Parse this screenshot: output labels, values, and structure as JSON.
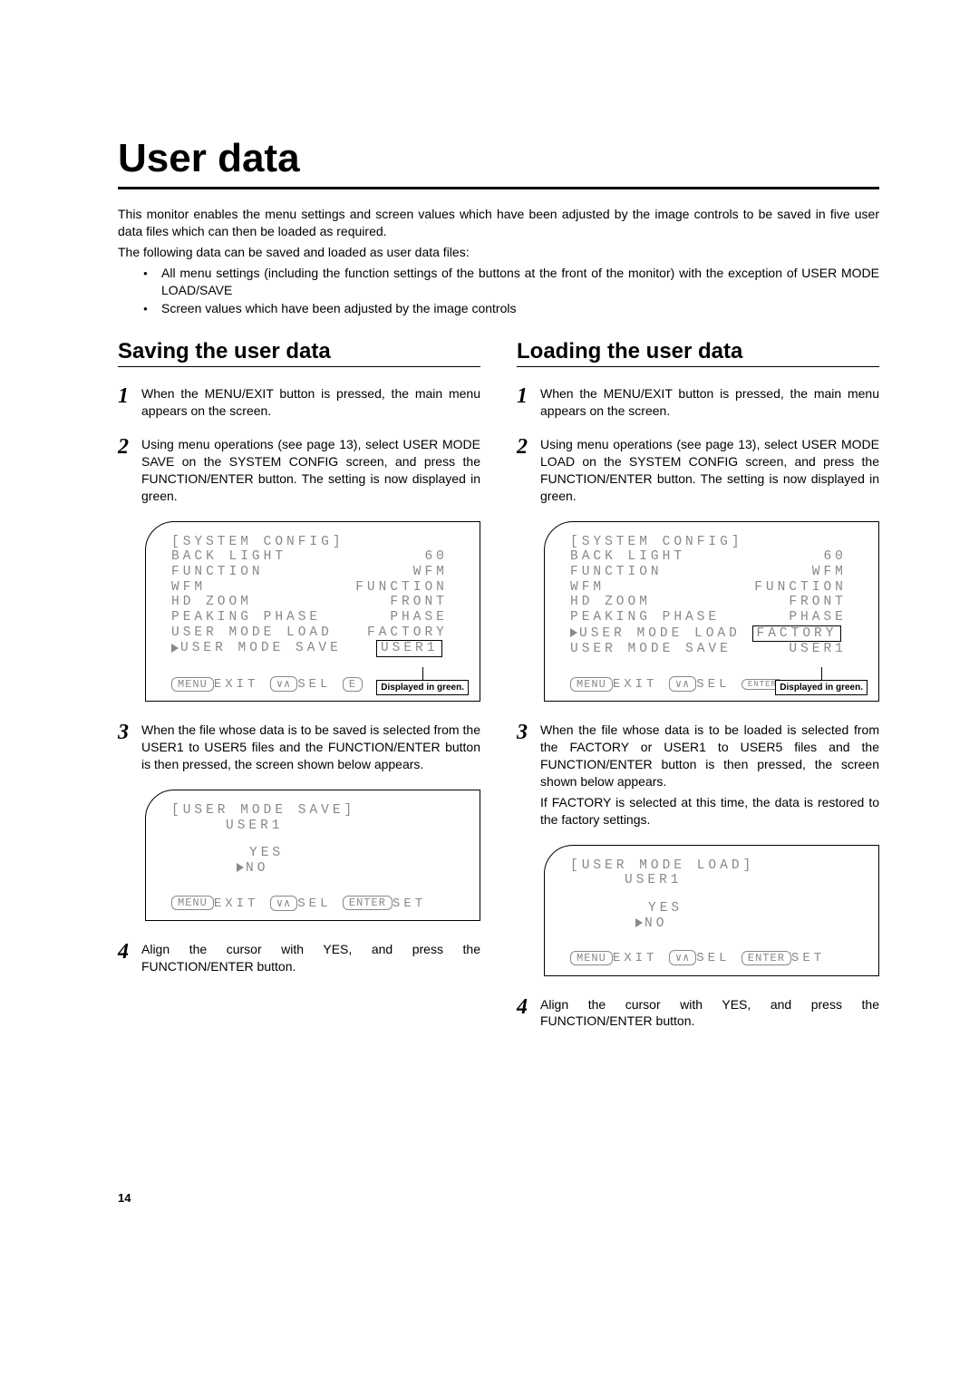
{
  "title": "User data",
  "intro_p1": "This monitor enables the menu settings and screen values which have been adjusted by the image controls to be saved in five user data files which can then be loaded as required.",
  "intro_p2": "The following data can be saved and loaded as user data files:",
  "bullets": [
    "All menu settings (including the function settings of the buttons at the front of the monitor) with the exception of USER MODE LOAD/SAVE",
    "Screen values which have been adjusted by the image controls"
  ],
  "saving": {
    "heading": "Saving the user data",
    "steps": [
      "When the MENU/EXIT button is pressed, the main menu appears on the screen.",
      "Using menu operations (see page 13), select USER MODE SAVE on the SYSTEM CONFIG screen, and press the FUNCTION/ENTER button.  The setting is now displayed in green.",
      "When the file whose data is to be saved is selected from the USER1 to USER5 files and the FUNCTION/ENTER button is then pressed, the screen shown below appears.",
      "Align the cursor with YES, and press the FUNCTION/ENTER button."
    ]
  },
  "loading": {
    "heading": "Loading the user data",
    "steps": [
      "When the MENU/EXIT button is pressed, the main menu appears on the screen.",
      "Using menu operations (see page 13), select USER MODE LOAD on the SYSTEM CONFIG screen, and press the FUNCTION/ENTER button.  The setting is now displayed in green.",
      "When the file whose data is to be loaded is selected from the FACTORY or USER1 to USER5 files and the FUNCTION/ENTER button is then pressed, the screen shown below appears.",
      "Align the cursor with YES, and press the FUNCTION/ENTER button."
    ],
    "step3_extra": "If FACTORY is selected at this time, the data is restored to the factory settings."
  },
  "screen_syscfg": {
    "title": "[SYSTEM CONFIG]",
    "rows": {
      "back_light": {
        "label": "BACK LIGHT",
        "value": "60"
      },
      "function": {
        "label": "FUNCTION",
        "value": "WFM"
      },
      "wfm": {
        "label": "WFM",
        "value": "FUNCTION"
      },
      "hd_zoom": {
        "label": "HD ZOOM",
        "value": "FRONT"
      },
      "peaking": {
        "label": "PEAKING PHASE",
        "value": "PHASE"
      },
      "load": {
        "label": "USER MODE LOAD",
        "value_save": "FACTORY",
        "value_load": "FACTORY"
      },
      "save": {
        "label": "USER MODE SAVE",
        "value_save": "USER1",
        "value_load": "USER1"
      }
    },
    "bottom": {
      "exit": "EXIT",
      "sel": "SEL",
      "set": "SET",
      "menu": "MENU",
      "updown": "∨∧",
      "enter": "ENTER"
    }
  },
  "callout": "Displayed in green.",
  "confirm": {
    "save_title": "[USER MODE SAVE]",
    "load_title": "[USER MODE LOAD]",
    "file": "USER1",
    "yes": "YES",
    "no": "NO"
  },
  "page_number": "14"
}
